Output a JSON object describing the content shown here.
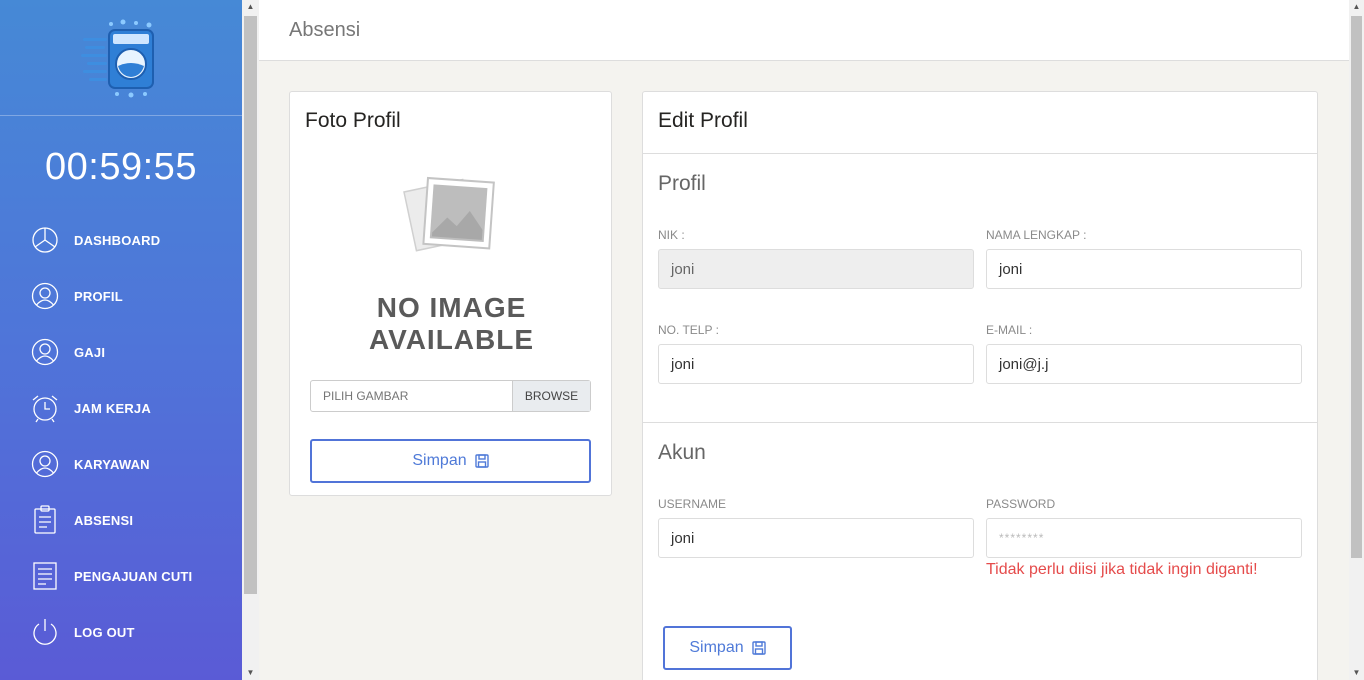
{
  "sidebar": {
    "clock": "00:59:55",
    "items": [
      {
        "label": "DASHBOARD",
        "icon": "pie-chart-icon"
      },
      {
        "label": "PROFIL",
        "icon": "user-icon"
      },
      {
        "label": "GAJI",
        "icon": "user-icon"
      },
      {
        "label": "JAM KERJA",
        "icon": "alarm-clock-icon"
      },
      {
        "label": "KARYAWAN",
        "icon": "user-icon"
      },
      {
        "label": "ABSENSI",
        "icon": "clipboard-icon"
      },
      {
        "label": "PENGAJUAN CUTI",
        "icon": "document-icon"
      },
      {
        "label": "LOG OUT",
        "icon": "power-icon"
      }
    ]
  },
  "header": {
    "title": "Absensi"
  },
  "foto": {
    "title": "Foto Profil",
    "noimage_line1": "NO IMAGE",
    "noimage_line2": "AVAILABLE",
    "file_placeholder": "PILIH GAMBAR",
    "browse_label": "BROWSE",
    "save_label": "Simpan"
  },
  "edit": {
    "title": "Edit Profil",
    "profil_title": "Profil",
    "nik_label": "NIK :",
    "nik_value": "joni",
    "nama_label": "NAMA LENGKAP :",
    "nama_value": "joni",
    "telp_label": "NO. TELP :",
    "telp_value": "joni",
    "email_label": "E-MAIL :",
    "email_value": "joni@j.j",
    "akun_title": "Akun",
    "username_label": "USERNAME",
    "username_value": "joni",
    "password_label": "PASSWORD",
    "password_placeholder": "********",
    "password_hint": "Tidak perlu diisi jika tidak ingin diganti!",
    "save_label": "Simpan"
  },
  "colors": {
    "accent": "#5174d8",
    "warning": "#e54b4b",
    "sidebar_top": "#4689d6",
    "sidebar_bottom": "#5a5bd6"
  }
}
